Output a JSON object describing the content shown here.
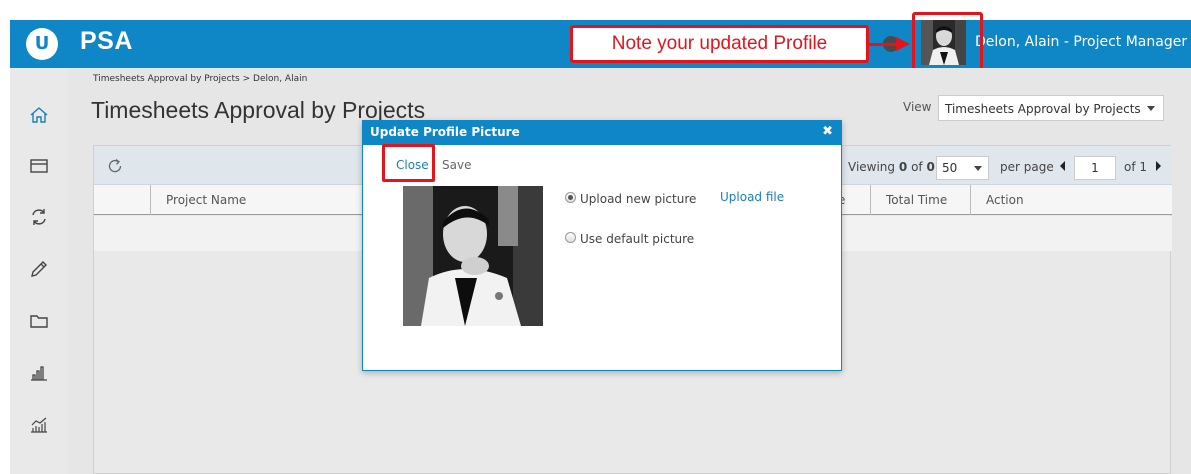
{
  "header": {
    "logo_letter": "U",
    "app_name": "PSA",
    "user_label": "Delon, Alain - Project Manager"
  },
  "callout": {
    "text": "Note your updated Profile"
  },
  "sidebar": {
    "items": [
      {
        "icon": "home-icon"
      },
      {
        "icon": "timesheet-icon"
      },
      {
        "icon": "refresh-cycle-icon"
      },
      {
        "icon": "pencil-icon"
      },
      {
        "icon": "folder-icon"
      },
      {
        "icon": "bar-chart-icon"
      },
      {
        "icon": "trend-chart-icon"
      }
    ]
  },
  "main": {
    "breadcrumb": "Timesheets Approval by Projects > Delon, Alain",
    "title": "Timesheets Approval by Projects",
    "view_label": "View",
    "view_value": "Timesheets Approval by Projects"
  },
  "grid": {
    "viewing_prefix": "Viewing",
    "viewing_from": "0",
    "viewing_of": "of",
    "viewing_total": "0",
    "per_page_value": "50",
    "per_page_label": "per page",
    "page_value": "1",
    "of_pages": "of 1",
    "columns": [
      "Project Name",
      "e",
      "Total Time",
      "Action"
    ]
  },
  "modal": {
    "title": "Update Profile Picture",
    "close_symbol": "✖",
    "close_label": "Close",
    "save_label": "Save",
    "option_upload": "Upload new picture",
    "option_default": "Use default picture",
    "upload_link": "Upload file"
  },
  "colors": {
    "brand_blue": "#0f86c6",
    "highlight_red": "#e3141c",
    "link_blue": "#1a7fb8"
  }
}
